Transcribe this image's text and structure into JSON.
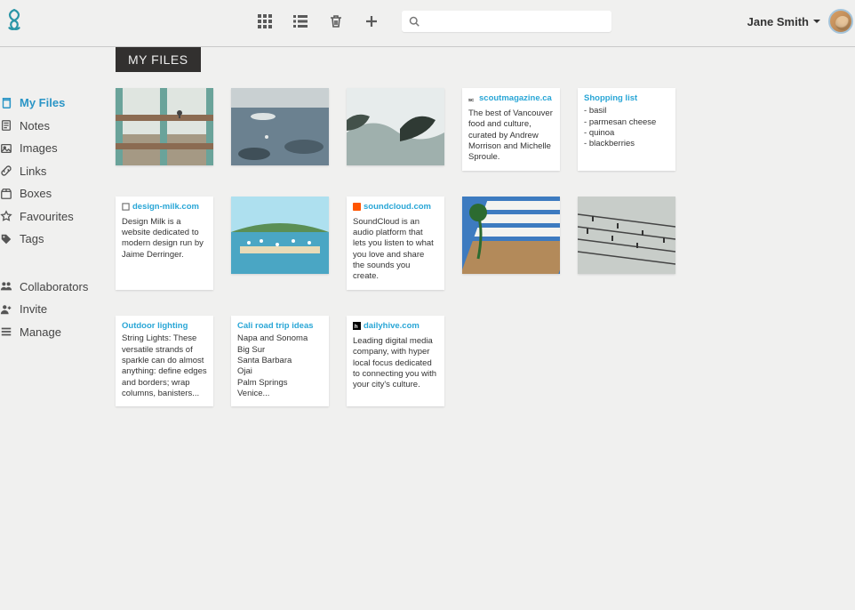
{
  "header": {
    "user_name": "Jane Smith",
    "search_placeholder": ""
  },
  "page_title": "MY FILES",
  "sidebar": {
    "primary": [
      {
        "label": "My Files",
        "icon": "copy-icon",
        "active": true
      },
      {
        "label": "Notes",
        "icon": "note-icon"
      },
      {
        "label": "Images",
        "icon": "image-icon"
      },
      {
        "label": "Links",
        "icon": "link-icon"
      },
      {
        "label": "Boxes",
        "icon": "box-icon"
      },
      {
        "label": "Favourites",
        "icon": "star-icon"
      },
      {
        "label": "Tags",
        "icon": "tag-icon"
      }
    ],
    "secondary": [
      {
        "label": "Collaborators",
        "icon": "users-icon"
      },
      {
        "label": "Invite",
        "icon": "user-plus-icon"
      },
      {
        "label": "Manage",
        "icon": "list-icon"
      }
    ]
  },
  "cards": {
    "c4": {
      "host": "scoutmagazine.ca",
      "body": "The best of Vancouver food and culture, curated by Andrew Morrison and Michelle Sproule."
    },
    "c5": {
      "title": "Shopping list",
      "items": [
        "basil",
        "parmesan cheese",
        "quinoa",
        "blackberries"
      ]
    },
    "c6": {
      "host": "design-milk.com",
      "body": "Design Milk is a website dedicated to modern design run by Jaime Derringer."
    },
    "c8": {
      "host": "soundcloud.com",
      "body": "SoundCloud is an audio platform that lets you listen to what you love and share the sounds you create."
    },
    "c11": {
      "title": "Outdoor lighting",
      "body": "String Lights: These versatile strands of sparkle can do almost anything: define edges and borders; wrap columns, banisters..."
    },
    "c12": {
      "title": "Cali road trip ideas",
      "lines": [
        "Napa and Sonoma",
        "Big Sur",
        "Santa Barbara",
        "Ojai",
        "Palm Springs",
        "Venice..."
      ]
    },
    "c13": {
      "host": "dailyhive.com",
      "body": "Leading digital media company, with hyper local focus dedicated to connecting you with your city's culture."
    }
  }
}
